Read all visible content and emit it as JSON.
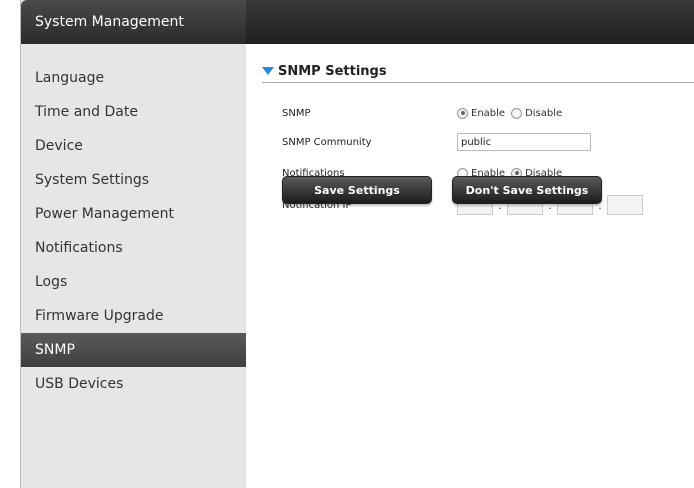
{
  "sidebar": {
    "title": "System Management",
    "items": [
      {
        "label": "Language"
      },
      {
        "label": "Time and Date"
      },
      {
        "label": "Device"
      },
      {
        "label": "System Settings"
      },
      {
        "label": "Power Management"
      },
      {
        "label": "Notifications"
      },
      {
        "label": "Logs"
      },
      {
        "label": "Firmware Upgrade"
      },
      {
        "label": "SNMP"
      },
      {
        "label": "USB Devices"
      }
    ],
    "active_item": "SNMP"
  },
  "section": {
    "title": "SNMP Settings"
  },
  "form": {
    "snmp": {
      "label": "SNMP",
      "enable_label": "Enable",
      "disable_label": "Disable",
      "selected": "Enable"
    },
    "community": {
      "label": "SNMP Community",
      "value": "public"
    },
    "notifications": {
      "label": "Notifications",
      "enable_label": "Enable",
      "disable_label": "Disable",
      "selected": "Disable"
    },
    "notification_ip": {
      "label": "Notification IP",
      "octets": [
        "",
        "",
        "",
        ""
      ],
      "separator": "."
    }
  },
  "buttons": {
    "save": "Save Settings",
    "dont_save": "Don't Save Settings"
  },
  "colors": {
    "accent": "#2a8ad4",
    "sidebar_bg": "#e6e6e6",
    "active_item_bg": "#4a4a4a"
  }
}
